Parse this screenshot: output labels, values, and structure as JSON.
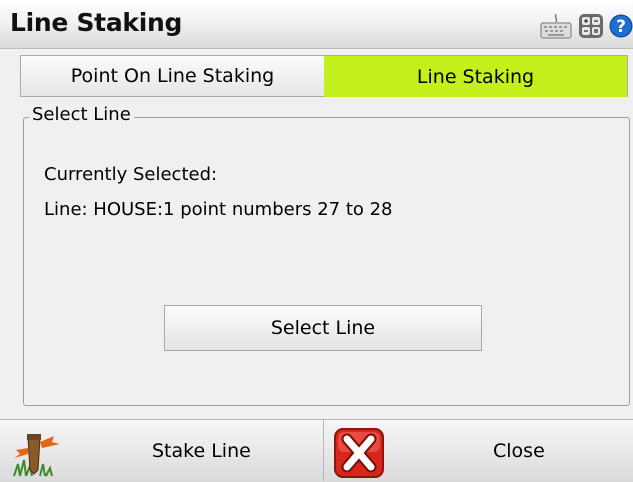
{
  "window": {
    "title": "Line Staking"
  },
  "header_icons": [
    "keyboard-icon",
    "calculator-icon",
    "help-icon"
  ],
  "tabs": [
    {
      "label": "Point On Line Staking",
      "active": false
    },
    {
      "label": "Line Staking",
      "active": true
    }
  ],
  "group": {
    "legend": "Select Line",
    "currently_selected_label": "Currently Selected:",
    "line_value": "Line: HOUSE:1 point numbers 27 to 28",
    "select_button_label": "Select Line"
  },
  "toolbar": {
    "stake_label": "Stake Line",
    "close_label": "Close"
  },
  "colors": {
    "active_tab": "#c4f01c",
    "close_red": "#d8261c",
    "help_blue": "#1c6fd0"
  }
}
